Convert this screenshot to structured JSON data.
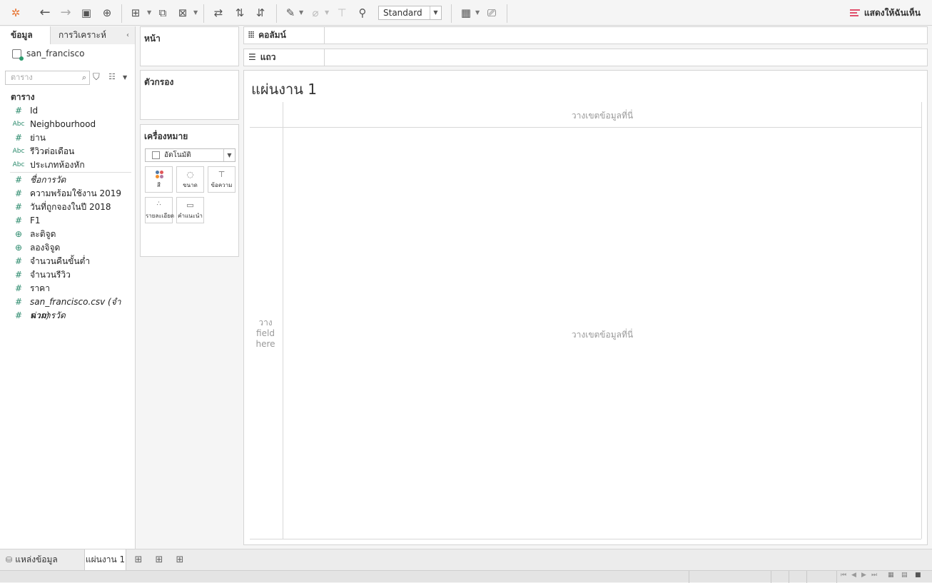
{
  "toolbar": {
    "fit_value": "Standard",
    "show_me_label": "แสดงให้ฉันเห็น",
    "icons": [
      "tableau-logo-icon",
      "undo-icon",
      "redo-icon",
      "save-icon",
      "new-datasource-icon",
      "new-worksheet-icon",
      "duplicate-icon",
      "clear-sheet-icon",
      "swap-icon",
      "sort-ascending-icon",
      "sort-descending-icon",
      "highlight-icon",
      "group-icon",
      "label-icon",
      "pin-icon",
      "show-cards-icon",
      "presentation-icon"
    ]
  },
  "data_pane": {
    "tab_data": "ข้อมูล",
    "tab_analysis": "การวิเคราะห์",
    "datasource_name": "san_francisco",
    "search_placeholder": "ตาราง",
    "tables_heading": "ตาราง",
    "fields": [
      {
        "type": "#",
        "label": "Id",
        "italic": false
      },
      {
        "type": "Abc",
        "label": "Neighbourhood",
        "italic": false
      },
      {
        "type": "#",
        "label": "ย่าน",
        "italic": false
      },
      {
        "type": "Abc",
        "label": "รีวิวต่อเดือน",
        "italic": false
      },
      {
        "type": "Abc",
        "label": "ประเภทห้องหัก",
        "italic": false
      }
    ],
    "measures": [
      {
        "type": "#",
        "label": "ชื่อการวัด",
        "italic": true
      },
      {
        "type": "#",
        "label": "ความพร้อมใช้งาน 2019",
        "italic": false
      },
      {
        "type": "#",
        "label": "วันที่ถูกจองในปี 2018",
        "italic": false
      },
      {
        "type": "#",
        "label": "F1",
        "italic": false
      },
      {
        "type": "globe",
        "label": "ละติจูด",
        "italic": false
      },
      {
        "type": "globe",
        "label": "ลองจิจูด",
        "italic": false
      },
      {
        "type": "#",
        "label": "จำนวนคืนขั้นต่ำ",
        "italic": false
      },
      {
        "type": "#",
        "label": "จำนวนรีวิว",
        "italic": false
      },
      {
        "type": "#",
        "label": "ราคา",
        "italic": false
      },
      {
        "type": "#",
        "label": "san_francisco.csv (จำนวม)",
        "italic": true
      },
      {
        "type": "#",
        "label": "ค่าการวัด",
        "italic": true
      }
    ]
  },
  "cards": {
    "pages": "หน้า",
    "filters": "ตัวกรอง",
    "marks": "เครื่องหมาย",
    "marks_type": "อัตโนมัติ",
    "mark_buttons": {
      "color": "สี",
      "size": "ขนาด",
      "text": "ข้อความ",
      "detail": "รายละเอียด",
      "tooltip": "คำแนะนำ"
    }
  },
  "shelves": {
    "columns": "คอลัมน์",
    "rows": "แถว"
  },
  "canvas": {
    "sheet_title": "แผ่นงาน 1",
    "drop_field_top": "วางเขตข้อมูลที่นี่",
    "drop_field_center": "วางเขตข้อมูลที่นี่",
    "drop_field_left": "วาง field here"
  },
  "bottom_tabs": {
    "datasource": "แหล่งข้อมูล",
    "sheet1": "แผ่นงาน 1"
  }
}
